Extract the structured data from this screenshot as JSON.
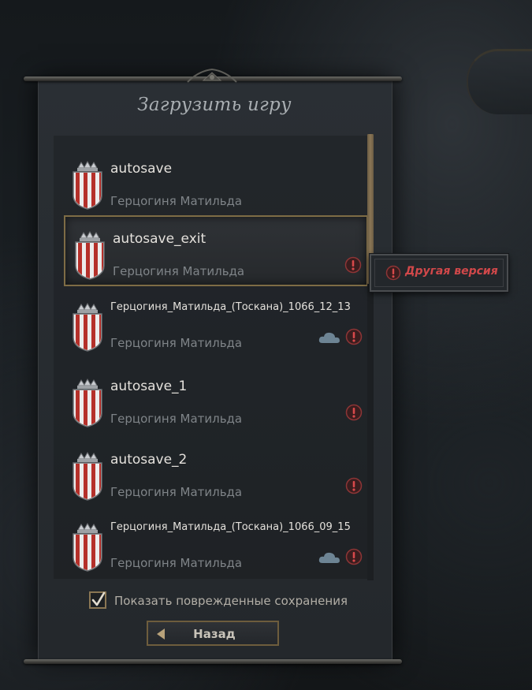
{
  "dialog": {
    "title": "Загрузить игру"
  },
  "saves": [
    {
      "name": "autosave",
      "character": "Герцогиня Матильда",
      "warning": false,
      "cloud": false,
      "selected": false
    },
    {
      "name": "autosave_exit",
      "character": "Герцогиня Матильда",
      "warning": true,
      "cloud": false,
      "selected": true
    },
    {
      "name": "Герцогиня_Матильда_(Тоскана)_1066_12_13",
      "character": "Герцогиня Матильда",
      "warning": true,
      "cloud": true,
      "selected": false
    },
    {
      "name": "autosave_1",
      "character": "Герцогиня Матильда",
      "warning": true,
      "cloud": false,
      "selected": false
    },
    {
      "name": "autosave_2",
      "character": "Герцогиня Матильда",
      "warning": true,
      "cloud": false,
      "selected": false
    },
    {
      "name": "Герцогиня_Матильда_(Тоскана)_1066_09_15",
      "character": "Герцогиня Матильда",
      "warning": true,
      "cloud": true,
      "selected": false
    }
  ],
  "tooltip": {
    "text": "Другая версия"
  },
  "options": {
    "show_corrupted_label": "Показать поврежденные сохранения",
    "show_corrupted_checked": true
  },
  "buttons": {
    "back_label": "Назад"
  },
  "colors": {
    "accent_gold": "#8a7653",
    "warning_red": "#d1484a",
    "crest_red": "#b5302a"
  }
}
